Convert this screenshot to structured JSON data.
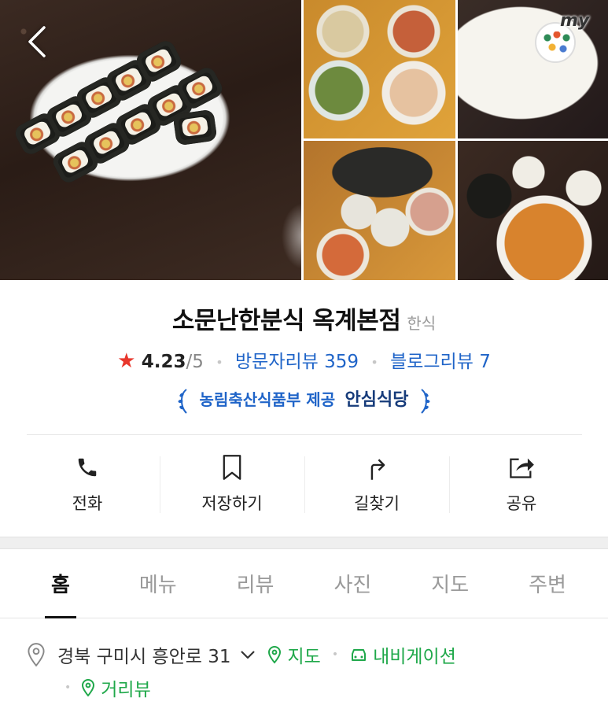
{
  "header": {
    "back_icon": "chevron-left-icon",
    "my_badge_label": "my"
  },
  "place": {
    "name": "소문난한분식 옥계본점",
    "category": "한식",
    "rating": "4.23",
    "rating_max": "/5",
    "visitor_reviews": "방문자리뷰 359",
    "blog_reviews": "블로그리뷰 7",
    "cert_org": "농림축산식품부 제공",
    "cert_name": "안심식당"
  },
  "actions": [
    {
      "label": "전화",
      "icon": "phone-icon"
    },
    {
      "label": "저장하기",
      "icon": "bookmark-icon"
    },
    {
      "label": "길찾기",
      "icon": "directions-icon"
    },
    {
      "label": "공유",
      "icon": "share-icon"
    }
  ],
  "tabs": [
    {
      "label": "홈",
      "active": true
    },
    {
      "label": "메뉴"
    },
    {
      "label": "리뷰"
    },
    {
      "label": "사진"
    },
    {
      "label": "지도"
    },
    {
      "label": "주변"
    }
  ],
  "address": {
    "text": "경북 구미시 흥안로 31",
    "map_link": "지도",
    "navigation_link": "내비게이션",
    "streetview_link": "거리뷰"
  },
  "colors": {
    "link_blue": "#1f64c8",
    "link_green": "#1fa84a",
    "star_red": "#e8372c"
  }
}
